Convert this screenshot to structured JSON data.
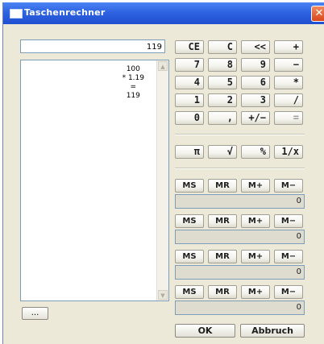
{
  "window": {
    "title": "Taschenrechner",
    "close_glyph": "✕"
  },
  "display": {
    "value": "119"
  },
  "tape": {
    "lines": [
      "100",
      "* 1.19",
      "=",
      "119"
    ]
  },
  "small_button": {
    "label": "..."
  },
  "keypad": {
    "row1": [
      "CE",
      "C",
      "<<",
      "+"
    ],
    "row2": [
      "7",
      "8",
      "9",
      "−"
    ],
    "row3": [
      "4",
      "5",
      "6",
      "*"
    ],
    "row4": [
      "1",
      "2",
      "3",
      "/"
    ],
    "row5": [
      "0",
      ",",
      "+/−",
      "="
    ],
    "functions": [
      "π",
      "√",
      "%",
      "1/x"
    ]
  },
  "memory": {
    "labels": [
      "MS",
      "MR",
      "M+",
      "M−"
    ],
    "values": [
      "0",
      "0",
      "0",
      "0"
    ]
  },
  "actions": {
    "ok": "OK",
    "cancel": "Abbruch"
  }
}
